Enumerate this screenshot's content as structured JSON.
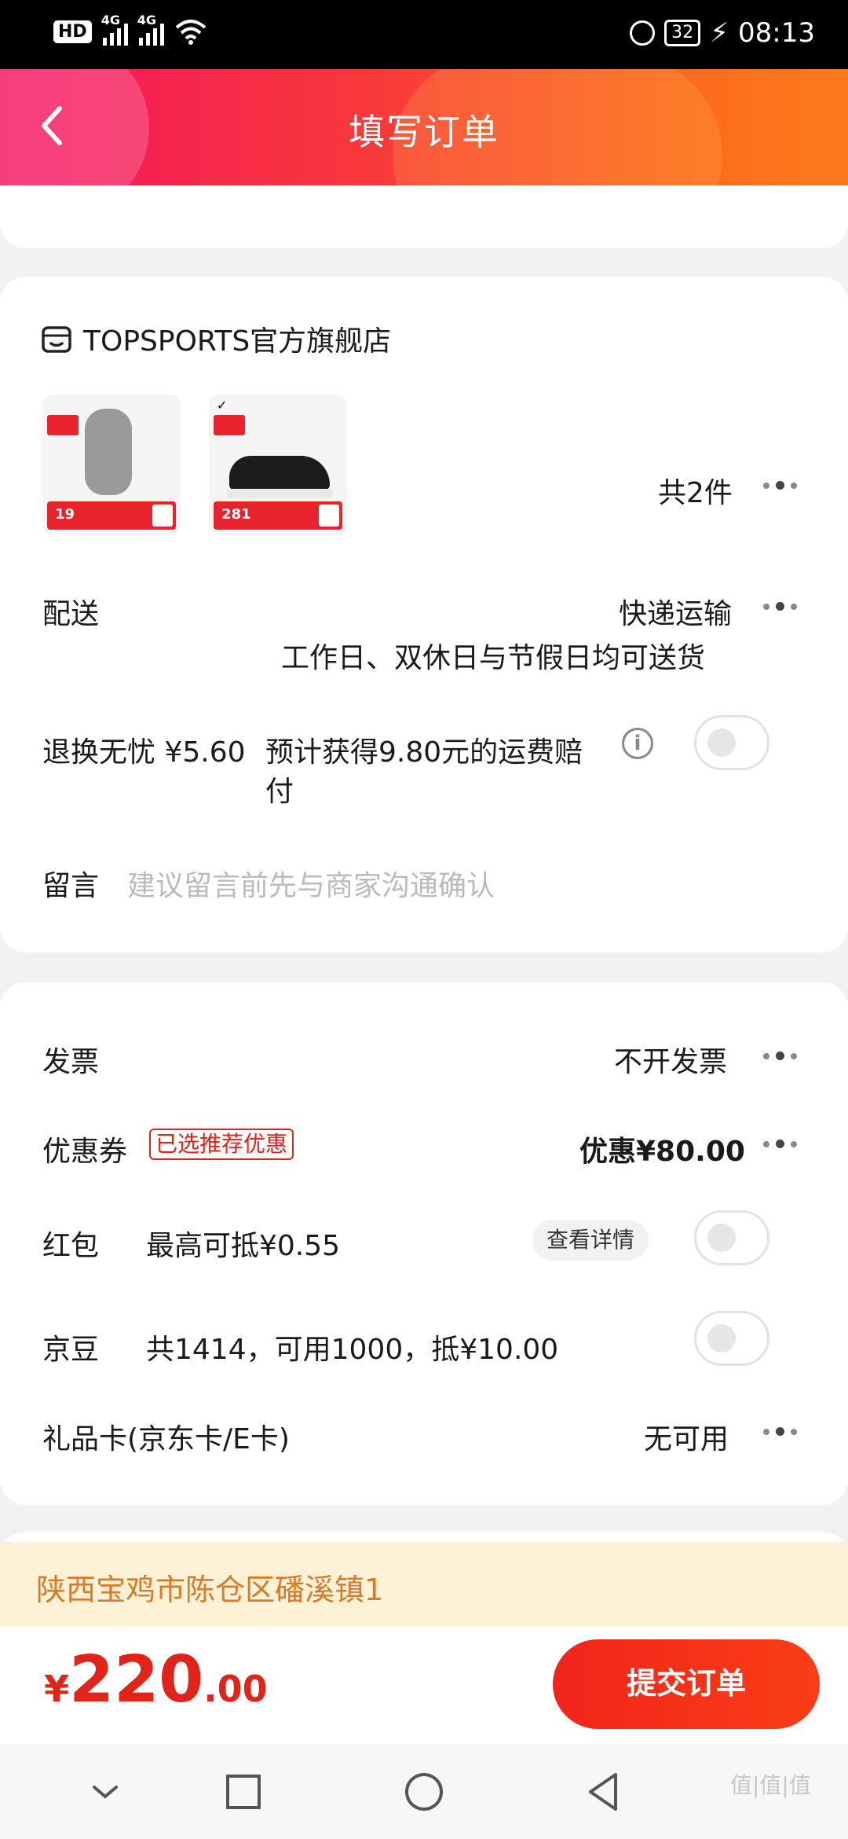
{
  "status_bar": {
    "hd": "HD",
    "net1": "4G",
    "net2": "4G",
    "battery": "32",
    "time": "08:13"
  },
  "header": {
    "title": "填写订单"
  },
  "shop": {
    "name": "TOPSPORTS官方旗舰店",
    "products": [
      {
        "price_tag": "19"
      },
      {
        "price_tag": "281"
      }
    ],
    "count_label": "共2件",
    "delivery": {
      "label": "配送",
      "value": "快递运输",
      "note": "工作日、双休日与节假日均可送货"
    },
    "return_insurance": {
      "label": "退换无忧 ¥5.60",
      "desc_line1": "预计获得9.80元的运费赔",
      "desc_line2": "付",
      "enabled": false
    },
    "message": {
      "label": "留言",
      "placeholder": "建议留言前先与商家沟通确认"
    }
  },
  "payment": {
    "invoice": {
      "label": "发票",
      "value": "不开发票"
    },
    "coupon": {
      "label": "优惠券",
      "tag": "已选推荐优惠",
      "value": "优惠¥80.00"
    },
    "red_packet": {
      "label": "红包",
      "desc": "最高可抵¥0.55",
      "detail_button": "查看详情",
      "enabled": false
    },
    "jingdou": {
      "label": "京豆",
      "desc": "共1414，可用1000，抵¥10.00",
      "enabled": false
    },
    "gift_card": {
      "label": "礼品卡(京东卡/E卡)",
      "value": "无可用"
    }
  },
  "address_bar": "陕西宝鸡市陈仓区磻溪镇1",
  "footer": {
    "currency": "¥",
    "total_int": "220",
    "total_dec": ".00",
    "submit_label": "提交订单"
  },
  "watermark": "值|值|值",
  "colors": {
    "accent_red": "#e2231a",
    "header_gradient_start": "#f3135f",
    "header_gradient_end": "#fd7a1c",
    "address_bg": "#fdf1d6",
    "address_text": "#d97a2a"
  },
  "icons": [
    "back-icon",
    "store-icon",
    "more-dots-icon",
    "info-icon",
    "nav-back-icon",
    "nav-home-icon",
    "nav-recents-icon",
    "nav-hide-icon"
  ]
}
